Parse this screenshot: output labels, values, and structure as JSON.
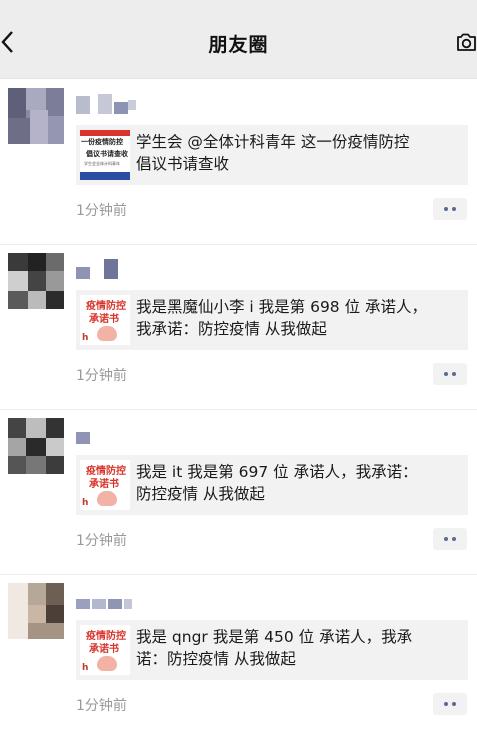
{
  "header": {
    "title": "朋友圈",
    "back_icon": "chevron-left-icon",
    "camera_icon": "camera-icon"
  },
  "posts": [
    {
      "thumb_lines": [
        "一份疫情防控",
        "倡议书请查收",
        "学生会全体计科青年"
      ],
      "text": "学生会 @全体计科青年  这一份疫情防控\n倡议书请查收",
      "time": "1分钟前"
    },
    {
      "thumb_lines": [
        "疫情防控",
        "承诺书"
      ],
      "text": "我是黑魔仙小李 i 我是第 698 位 承诺人，\n我承诺：防控疫情  从我做起",
      "time": "1分钟前"
    },
    {
      "thumb_lines": [
        "疫情防控",
        "承诺书"
      ],
      "text": "我是 it 我是第 697 位 承诺人，我承诺：\n防控疫情  从我做起",
      "time": "1分钟前"
    },
    {
      "thumb_lines": [
        "疫情防控",
        "承诺书"
      ],
      "text": "我是 qngr 我是第 450 位 承诺人，我承\n诺：防控疫情  从我做起",
      "time": "1分钟前"
    }
  ],
  "colors": {
    "header_bg": "#ededed",
    "card_bg": "#f2f2f2",
    "time": "#9a9a9a",
    "more_dots": "#576b95"
  }
}
